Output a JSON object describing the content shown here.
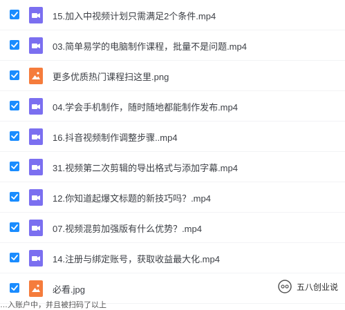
{
  "files": [
    {
      "name": "15.加入中视频计划只需满足2个条件.mp4",
      "type": "video",
      "checked": true
    },
    {
      "name": "03.简单易学的电脑制作课程，批量不是问题.mp4",
      "type": "video",
      "checked": true
    },
    {
      "name": "更多优质热门课程扫这里.png",
      "type": "image",
      "checked": true
    },
    {
      "name": "04.学会手机制作，随时随地都能制作发布.mp4",
      "type": "video",
      "checked": true
    },
    {
      "name": "16.抖音视频制作调整步骤..mp4",
      "type": "video",
      "checked": true
    },
    {
      "name": "31.视频第二次剪辑的导出格式与添加字幕.mp4",
      "type": "video",
      "checked": true
    },
    {
      "name": "12.你知道起爆文标题的新技巧吗？.mp4",
      "type": "video",
      "checked": true
    },
    {
      "name": "07.视频混剪加强版有什么优势？.mp4",
      "type": "video",
      "checked": true
    },
    {
      "name": "14.注册与绑定账号，获取收益最大化.mp4",
      "type": "video",
      "checked": true
    },
    {
      "name": "必看.jpg",
      "type": "image",
      "checked": true
    }
  ],
  "watermark": {
    "text": "五八创业说",
    "icon": "wechat-official-account-icon"
  },
  "bottom_cut_text": "…入账户中，并且被扫码了以上",
  "colors": {
    "checkbox": "#1a8cff",
    "video_icon": "#7b6ff0",
    "image_icon": "#f57c3c"
  }
}
